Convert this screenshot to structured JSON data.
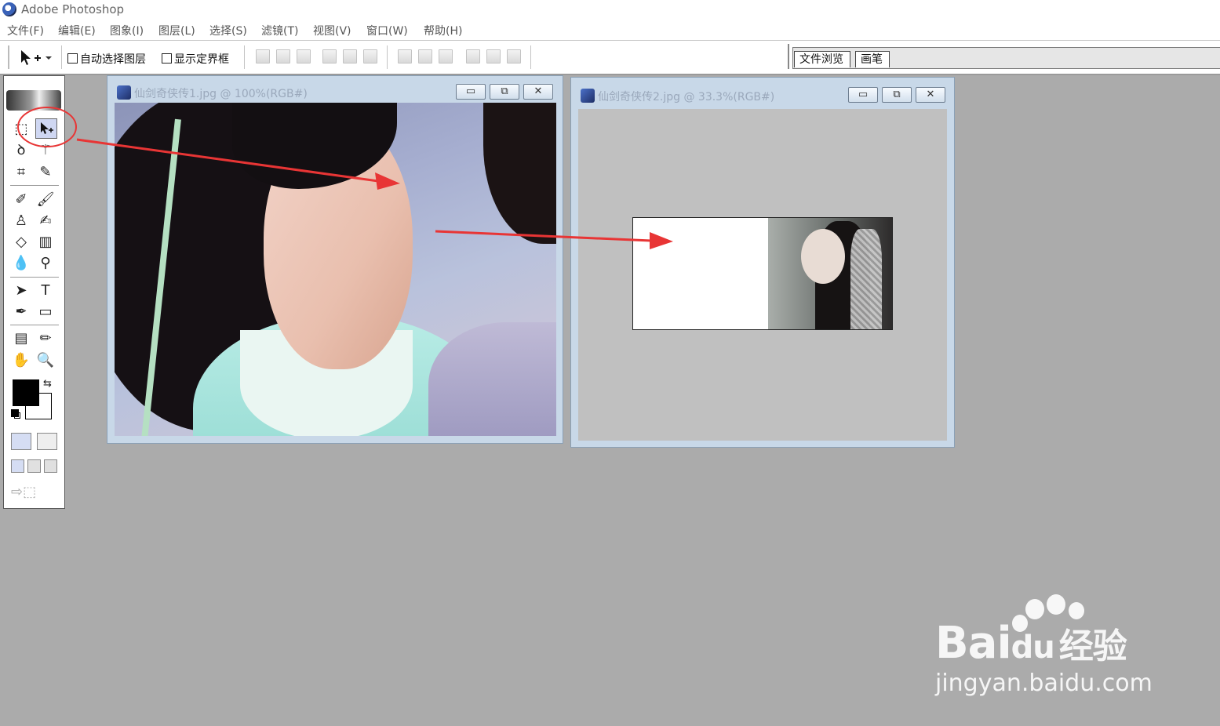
{
  "app": {
    "title": "Adobe Photoshop"
  },
  "menu": [
    "文件(F)",
    "编辑(E)",
    "图象(I)",
    "图层(L)",
    "选择(S)",
    "滤镜(T)",
    "视图(V)",
    "窗口(W)",
    "帮助(H)"
  ],
  "options": {
    "auto_select_label": "自动选择图层",
    "show_bounds_label": "显示定界框"
  },
  "palette_tabs": [
    "文件浏览",
    "画笔"
  ],
  "documents": [
    {
      "title": "仙剑奇侠传1.jpg @ 100%(RGB#)"
    },
    {
      "title": "仙剑奇侠传2.jpg @ 33.3%(RGB#)"
    }
  ],
  "window_buttons": {
    "minimize": "▭",
    "restore": "⧉",
    "close": "✕"
  },
  "watermark": {
    "logo": "Bai",
    "logo_mid": "du",
    "brand": "经验",
    "url": "jingyan.baidu.com"
  },
  "colors": {
    "annotation": "#e83535",
    "fg_color": "#000000",
    "bg_color": "#ffffff"
  }
}
